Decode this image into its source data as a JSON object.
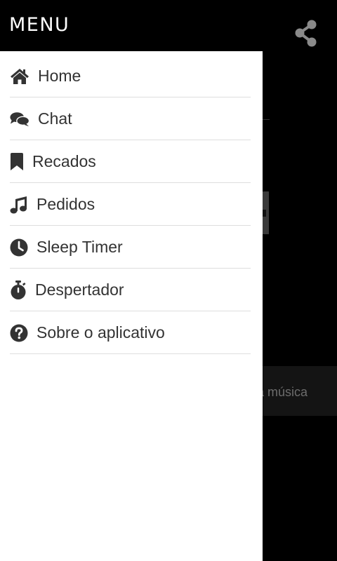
{
  "header": {
    "title": "MENU",
    "share_icon": "share-icon"
  },
  "background": {
    "song_text": "a música"
  },
  "menu": {
    "items": [
      {
        "label": "Home",
        "icon": "home-icon"
      },
      {
        "label": "Chat",
        "icon": "chat-icon"
      },
      {
        "label": "Recados",
        "icon": "bookmark-icon"
      },
      {
        "label": "Pedidos",
        "icon": "music-icon"
      },
      {
        "label": "Sleep Timer",
        "icon": "clock-icon"
      },
      {
        "label": "Despertador",
        "icon": "stopwatch-icon"
      },
      {
        "label": "Sobre o aplicativo",
        "icon": "question-icon"
      }
    ]
  },
  "colors": {
    "header_bg": "#000000",
    "drawer_bg": "#ffffff",
    "text": "#333333",
    "divider": "#dedede"
  }
}
